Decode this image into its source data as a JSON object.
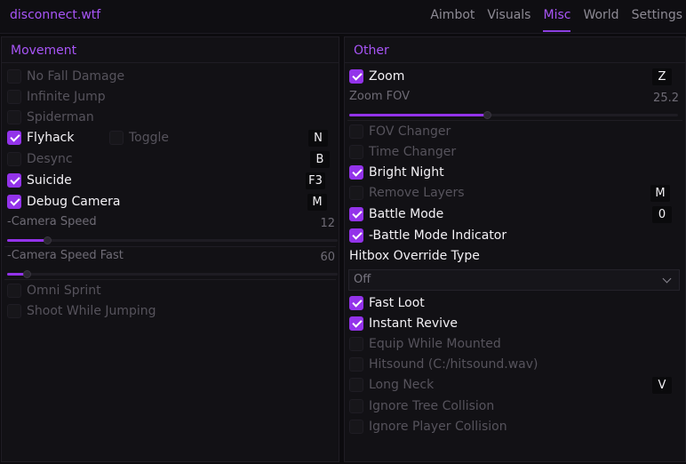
{
  "app": {
    "title": "disconnect.wtf"
  },
  "tabs": [
    "Aimbot",
    "Visuals",
    "Misc",
    "World",
    "Settings"
  ],
  "active_tab": "Misc",
  "accent_color": "#9333ea",
  "movement": {
    "title": "Movement",
    "no_fall_damage": {
      "label": "No Fall Damage",
      "checked": false
    },
    "infinite_jump": {
      "label": "Infinite Jump",
      "checked": false
    },
    "spiderman": {
      "label": "Spiderman",
      "checked": false
    },
    "flyhack": {
      "label": "Flyhack",
      "checked": true,
      "key": "N"
    },
    "toggle": {
      "label": "Toggle",
      "checked": false
    },
    "desync": {
      "label": "Desync",
      "checked": false,
      "key": "B"
    },
    "suicide": {
      "label": "Suicide",
      "checked": true,
      "key": "F3"
    },
    "debug_camera": {
      "label": "Debug Camera",
      "checked": true,
      "key": "M"
    },
    "camera_speed": {
      "label": "-Camera Speed",
      "value": "12",
      "fraction": 0.12
    },
    "camera_speed_fast": {
      "label": "-Camera Speed Fast",
      "value": "60",
      "fraction": 0.06
    },
    "omni_sprint": {
      "label": "Omni Sprint",
      "checked": false
    },
    "shoot_while_jumping": {
      "label": "Shoot While Jumping",
      "checked": false
    }
  },
  "other": {
    "title": "Other",
    "zoom": {
      "label": "Zoom",
      "checked": true,
      "key": "Z"
    },
    "zoom_fov": {
      "label": "Zoom FOV",
      "value": "25.2",
      "fraction": 0.42
    },
    "fov_changer": {
      "label": "FOV Changer",
      "checked": false
    },
    "time_changer": {
      "label": "Time Changer",
      "checked": false
    },
    "bright_night": {
      "label": "Bright Night",
      "checked": true
    },
    "remove_layers": {
      "label": "Remove Layers",
      "checked": false,
      "key": "M"
    },
    "battle_mode": {
      "label": "Battle Mode",
      "checked": true,
      "key": "0"
    },
    "battle_mode_indicator": {
      "label": "-Battle Mode Indicator",
      "checked": true
    },
    "hitbox_override": {
      "label": "Hitbox Override Type",
      "selected": "Off"
    },
    "fast_loot": {
      "label": "Fast Loot",
      "checked": true
    },
    "instant_revive": {
      "label": "Instant Revive",
      "checked": true
    },
    "equip_while_mounted": {
      "label": "Equip While Mounted",
      "checked": false
    },
    "hitsound": {
      "label": "Hitsound (C:/hitsound.wav)",
      "checked": false
    },
    "long_neck": {
      "label": "Long Neck",
      "checked": false,
      "key": "V"
    },
    "ignore_tree_collision": {
      "label": "Ignore Tree Collision",
      "checked": false
    },
    "ignore_player_collision": {
      "label": "Ignore Player Collision",
      "checked": false
    }
  }
}
